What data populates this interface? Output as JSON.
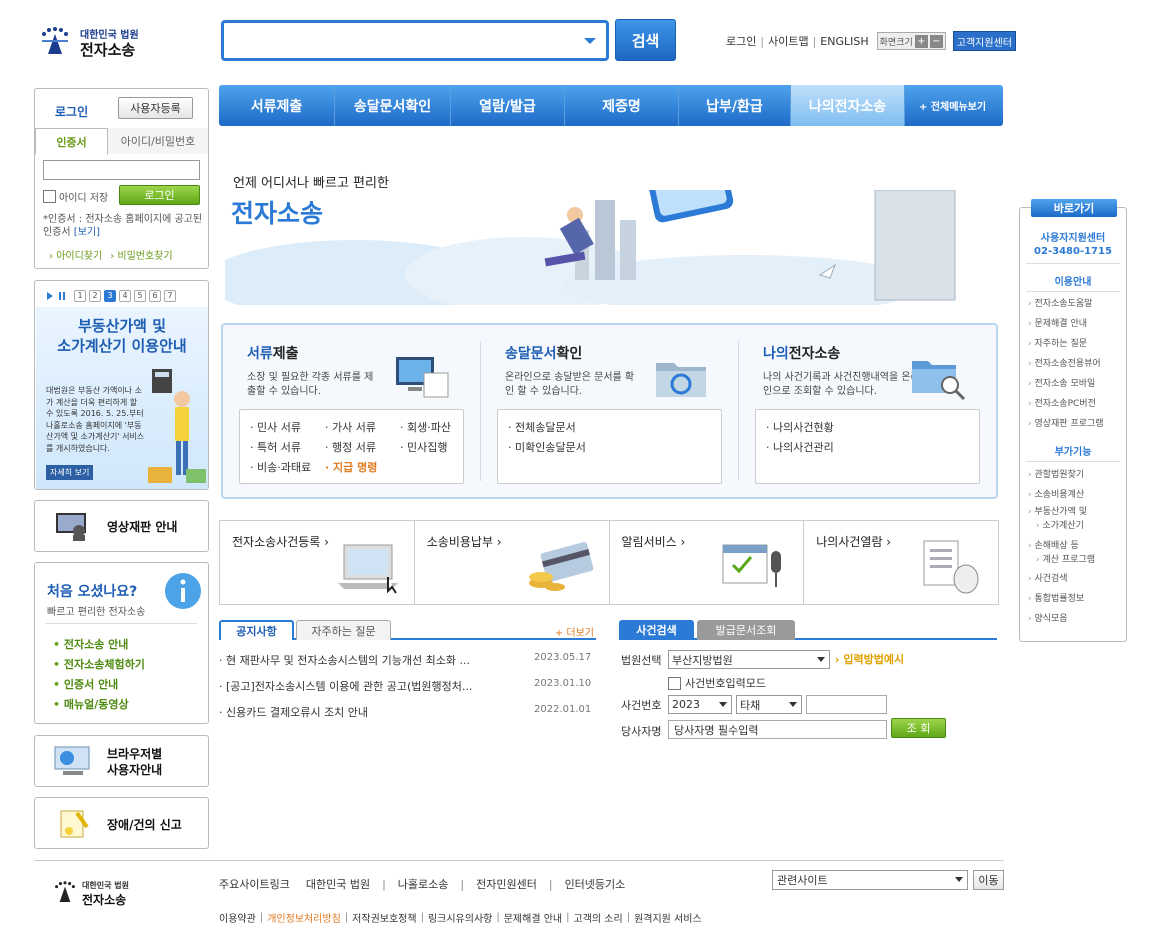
{
  "header": {
    "logo_small": "대한민국 법원",
    "logo_big": "전자소송",
    "search_button": "검색",
    "links": [
      "로그인",
      "사이트맵",
      "ENGLISH"
    ],
    "zoom_label": "화면크기",
    "zoom_plus": "+",
    "zoom_minus": "−",
    "help_center": "고객지원센터"
  },
  "nav": {
    "items": [
      "서류제출",
      "송달문서확인",
      "열람/발급",
      "제증명",
      "납부/환급",
      "나의전자소송"
    ],
    "all_menu": "+ 전체메뉴보기"
  },
  "login": {
    "title": "로그인",
    "register": "사용자등록",
    "tab_cert": "인증서",
    "tab_id": "아이디/비밀번호",
    "save_id": "아이디 저장",
    "login_button": "로그인",
    "note": "*인증서 : 전자소송 홈페이지에 공고된 인증서",
    "note_link": "[보기]",
    "find_id": "아이디찾기",
    "find_pw": "비밀번호찾기"
  },
  "banner": {
    "pages": [
      "1",
      "2",
      "3",
      "4",
      "5",
      "6",
      "7"
    ],
    "title1": "부동산가액 및",
    "title2": "소가계산기 이용안내",
    "desc": "대법원은 부동산 가액이나 소가 계산을 더욱 편리하게 할 수 있도록 2016. 5. 25.부터 나홀로소송 홈페이지에 '부동산가액 및 소가계산기' 서비스를 개시하였습니다.",
    "more": "자세히 보기"
  },
  "video_trial": "영상재판 안내",
  "first_visit": {
    "title": "처음 오셨나요?",
    "subtitle": "빠르고 편리한 전자소송",
    "items": [
      "전자소송 안내",
      "전자소송체험하기",
      "인증서 안내",
      "매뉴얼/동영상"
    ]
  },
  "browser_guide": {
    "line1": "브라우저별",
    "line2": "사용자안내"
  },
  "report": "장애/건의 신고",
  "hero": {
    "tagline": "언제 어디서나 빠르고 편리한",
    "title": "전자소송"
  },
  "services": [
    {
      "title_hl": "서류",
      "title_rest": "제출",
      "desc": "소장 및 필요한 각종 서류를 제출할 수 있습니다.",
      "links": [
        "· 민사 서류",
        "· 가사 서류",
        "· 회생·파산",
        "· 특허 서류",
        "· 행정 서류",
        "· 민사집행",
        "· 비송·과태료",
        "· 지급 명령"
      ]
    },
    {
      "title_hl": "송달문서",
      "title_rest": "확인",
      "desc": "온라인으로 송달받은 문서를 확인 할 수 있습니다.",
      "links": [
        "· 전체송달문서",
        "· 미확인송달문서"
      ]
    },
    {
      "title_hl": "나의",
      "title_rest": "전자소송",
      "desc": "나의 사건기록과 사건진행내역을 온라인으로 조회할 수 있습니다.",
      "links": [
        "· 나의사건현황",
        "· 나의사건관리"
      ]
    }
  ],
  "quick_row": [
    "전자소송사건등록 ›",
    "소송비용납부 ›",
    "알림서비스 ›",
    "나의사건열람 ›"
  ],
  "notice": {
    "tab1": "공지사항",
    "tab2": "자주하는 질문",
    "more": "+ 더보기",
    "rows": [
      {
        "title": "· 현 재판사무 및 전자소송시스템의 기능개선 최소화 ...",
        "date": "2023.05.17"
      },
      {
        "title": "· [공고]전자소송시스템 이용에 관한 공고(법원행정처...",
        "date": "2023.01.10"
      },
      {
        "title": "· 신용카드 결제오류시 조치 안내",
        "date": "2022.01.01"
      }
    ]
  },
  "case_search": {
    "tab1": "사건검색",
    "tab2": "발급문서조회",
    "court_label": "법원선택",
    "court_value": "부산지방법원",
    "input_example": "입력방법예시",
    "case_no_input": "사건번호입력모드",
    "case_no_label": "사건번호",
    "year": "2023",
    "type": "타채",
    "party_label": "당사자명",
    "party_placeholder": "당사자명 필수입력",
    "search_button": "조 회"
  },
  "right_quick": {
    "title": "바로가기",
    "center": "사용자지원센터",
    "phone": "02-3480-1715",
    "sec1": "이용안내",
    "sec1_items": [
      "전자소송도움말",
      "문제해결 안내",
      "자주하는 질문",
      "전자소송전용뷰어",
      "전자소송 모바일",
      "전자소송PC버전",
      "영상재판 프로그램"
    ],
    "sec2": "부가기능",
    "sec2_items": [
      "관할법원찾기",
      "소송비용계산",
      "부동산가액 및",
      "소가계산기",
      "손해배상 등",
      "계산 프로그램",
      "사건검색",
      "통합법률정보",
      "양식모음"
    ]
  },
  "footer": {
    "logo_small": "대한민국 법원",
    "logo_big": "전자소송",
    "links_label": "주요사이트링크",
    "links": [
      "대한민국 법원",
      "나홀로소송",
      "전자민원센터",
      "인터넷등기소"
    ],
    "related": "관련사이트",
    "go": "이동",
    "bottom": [
      "이용약관",
      "개인정보처리방침",
      "저작권보호정책",
      "링크시유의사항",
      "문제해결 안내",
      "고객의 소리",
      "원격지원 서비스"
    ]
  }
}
